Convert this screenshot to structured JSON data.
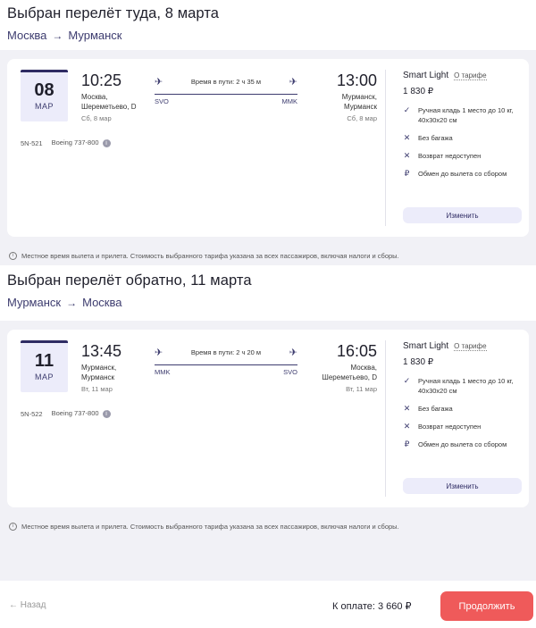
{
  "outbound": {
    "title": "Выбран перелёт туда, 8 марта",
    "route_from": "Москва",
    "route_to": "Мурманск",
    "date_day": "08",
    "date_month": "МАР",
    "dep_time": "10:25",
    "dep_city": "Москва,",
    "dep_city2": "Шереметьево, D",
    "dep_day": "Сб, 8 мар",
    "duration": "Время в пути: 2 ч 35 м",
    "code_from": "SVO",
    "code_to": "MMK",
    "arr_time": "13:00",
    "arr_city": "Мурманск,",
    "arr_city2": "Мурманск",
    "arr_day": "Сб, 8 мар",
    "flight_no": "5N-521",
    "aircraft": "Boeing 737-800",
    "tariff_name": "Smart Light",
    "tariff_link": "О тарифе",
    "tariff_price": "1 830 ₽",
    "features": [
      {
        "icon": "check-icon",
        "text": "Ручная кладь 1 место до 10 кг, 40х30х20 см"
      },
      {
        "icon": "cross-icon",
        "text": "Без багажа"
      },
      {
        "icon": "cross-icon",
        "text": "Возврат недоступен"
      },
      {
        "icon": "ruble-icon",
        "text": "Обмен до вылета со сбором"
      }
    ],
    "change_label": "Изменить"
  },
  "inbound": {
    "title": "Выбран перелёт обратно, 11 марта",
    "route_from": "Мурманск",
    "route_to": "Москва",
    "date_day": "11",
    "date_month": "МАР",
    "dep_time": "13:45",
    "dep_city": "Мурманск,",
    "dep_city2": "Мурманск",
    "dep_day": "Вт, 11 мар",
    "duration": "Время в пути: 2 ч 20 м",
    "code_from": "MMK",
    "code_to": "SVO",
    "arr_time": "16:05",
    "arr_city": "Москва,",
    "arr_city2": "Шереметьево, D",
    "arr_day": "Вт, 11 мар",
    "flight_no": "5N-522",
    "aircraft": "Boeing 737-800",
    "tariff_name": "Smart Light",
    "tariff_link": "О тарифе",
    "tariff_price": "1 830 ₽",
    "features": [
      {
        "icon": "check-icon",
        "text": "Ручная кладь 1 место до 10 кг, 40х30х20 см"
      },
      {
        "icon": "cross-icon",
        "text": "Без багажа"
      },
      {
        "icon": "cross-icon",
        "text": "Возврат недоступен"
      },
      {
        "icon": "ruble-icon",
        "text": "Обмен до вылета со сбором"
      }
    ],
    "change_label": "Изменить"
  },
  "note": "Местное время вылета и прилета. Стоимость выбранного тарифа указана за всех пассажиров, включая налоги и сборы.",
  "footer": {
    "back_label": "Назад",
    "total_label": "К оплате: 3 660 ₽",
    "continue_label": "Продолжить"
  },
  "colors": {
    "accent": "#2e2b63",
    "button_primary": "#ef5a5a",
    "chip_bg": "#ececfa"
  }
}
